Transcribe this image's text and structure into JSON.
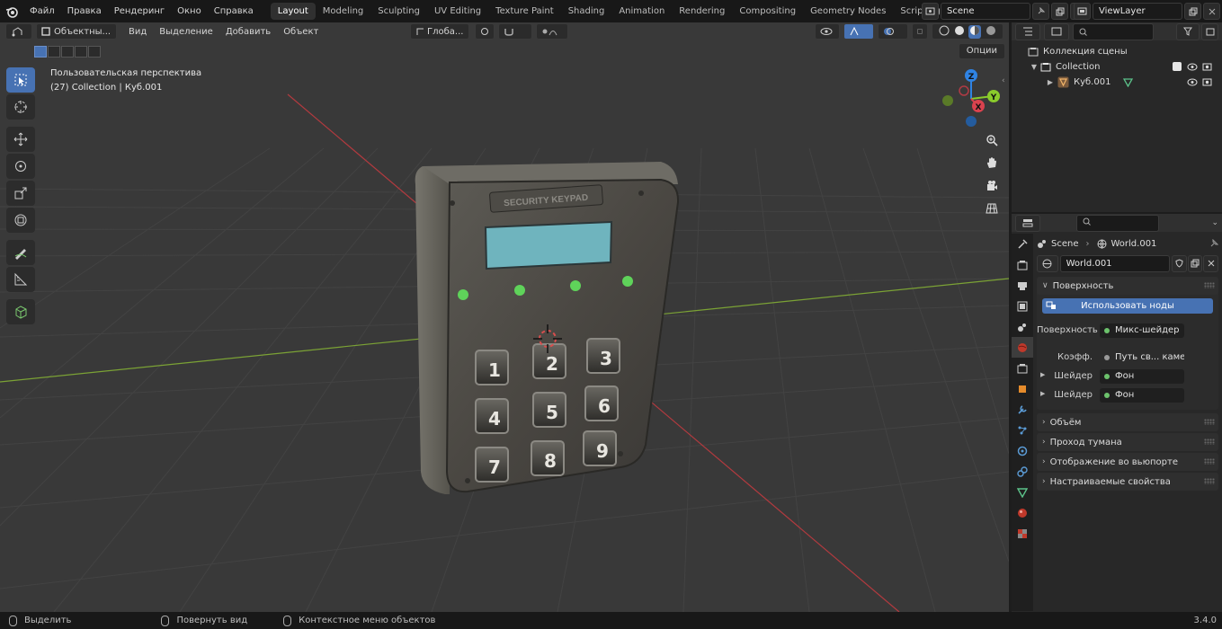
{
  "topbar": {
    "menus": [
      "Файл",
      "Правка",
      "Рендеринг",
      "Окно",
      "Справка"
    ],
    "workspaces": [
      "Layout",
      "Modeling",
      "Sculpting",
      "UV Editing",
      "Texture Paint",
      "Shading",
      "Animation",
      "Rendering",
      "Compositing",
      "Geometry Nodes",
      "Scripting"
    ],
    "active_workspace": "Layout",
    "scene_name": "Scene",
    "view_layer": "ViewLayer"
  },
  "viewport": {
    "mode_label": "Объектны...",
    "menu": [
      "Вид",
      "Выделение",
      "Добавить",
      "Объект"
    ],
    "transform_orientation": "Глоба...",
    "info_line1": "Пользовательская перспектива",
    "info_line2": "(27) Collection | Куб.001",
    "options_label": "Опции",
    "gizmo": {
      "x": "X",
      "y": "Y",
      "z": "Z"
    },
    "model": {
      "plate_text": "SECURITY KEYPAD",
      "keys": [
        "1",
        "2",
        "3",
        "4",
        "5",
        "6",
        "7",
        "8",
        "9"
      ]
    }
  },
  "statusbar": {
    "select": "Выделить",
    "rotate": "Повернуть вид",
    "context": "Контекстное меню объектов",
    "version": "3.4.0"
  },
  "outliner": {
    "scene_collection": "Коллекция сцены",
    "collection": "Collection",
    "object": "Куб.001"
  },
  "properties": {
    "breadcrumb_scene": "Scene",
    "breadcrumb_world": "World.001",
    "world_name": "World.001",
    "panel_surface": "Поверхность",
    "use_nodes": "Использовать ноды",
    "rows": [
      {
        "label": "Поверхность",
        "value": "Микс-шейдер",
        "expand": false
      },
      {
        "label": "Коэфф.",
        "value": "Путь св... камеры",
        "expand": false
      },
      {
        "label": "Шейдер",
        "value": "Фон",
        "expand": true
      },
      {
        "label": "Шейдер",
        "value": "Фон",
        "expand": true
      }
    ],
    "panels": [
      "Объём",
      "Проход тумана",
      "Отображение во вьюпорте",
      "Настраиваемые свойства"
    ]
  },
  "colors": {
    "accent": "#4772b3",
    "background": "#393939",
    "axis_x": "#d9424e",
    "axis_y": "#8acb2c",
    "axis_z": "#2f83e3",
    "led": "#5fd35a",
    "lcd": "#6fb4be"
  }
}
